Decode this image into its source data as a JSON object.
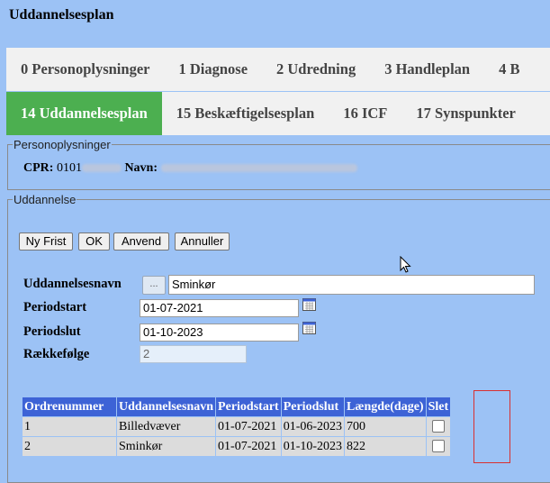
{
  "page_title": "Uddannelsesplan",
  "tabs_row1": [
    "0 Personoplysninger",
    "1 Diagnose",
    "2 Udredning",
    "3 Handleplan",
    "4 B"
  ],
  "tabs_row2": [
    "14 Uddannelsesplan",
    "15 Beskæftigelsesplan",
    "16 ICF",
    "17 Synspunkter"
  ],
  "active_tab": "14 Uddannelsesplan",
  "person": {
    "legend": "Personoplysninger",
    "cpr_label": "CPR:",
    "cpr_value": "0101",
    "name_label": "Navn:"
  },
  "education": {
    "legend": "Uddannelse",
    "buttons": {
      "new": "Ny Frist",
      "ok": "OK",
      "apply": "Anvend",
      "cancel": "Annuller"
    },
    "fields": {
      "name_label": "Uddannelsesnavn",
      "lookup_button": "...",
      "name_value": "Sminkør",
      "start_label": "Periodstart",
      "start_value": "01-07-2021",
      "end_label": "Periodslut",
      "end_value": "01-10-2023",
      "order_label": "Rækkefølge",
      "order_value": "2"
    },
    "table": {
      "headers": [
        "Ordrenummer",
        "Uddannelsesnavn",
        "Periodstart",
        "Periodslut",
        "Længde(dage)",
        "Slet"
      ],
      "rows": [
        [
          "1",
          "Billedvæver",
          "01-07-2021",
          "01-06-2023",
          "700"
        ],
        [
          "2",
          "Sminkør",
          "01-07-2021",
          "01-10-2023",
          "822"
        ]
      ]
    }
  },
  "colors": {
    "background": "#9cc2f5",
    "tab_active": "#4caf50",
    "table_header": "#3d63d6",
    "highlight": "#d93030"
  }
}
